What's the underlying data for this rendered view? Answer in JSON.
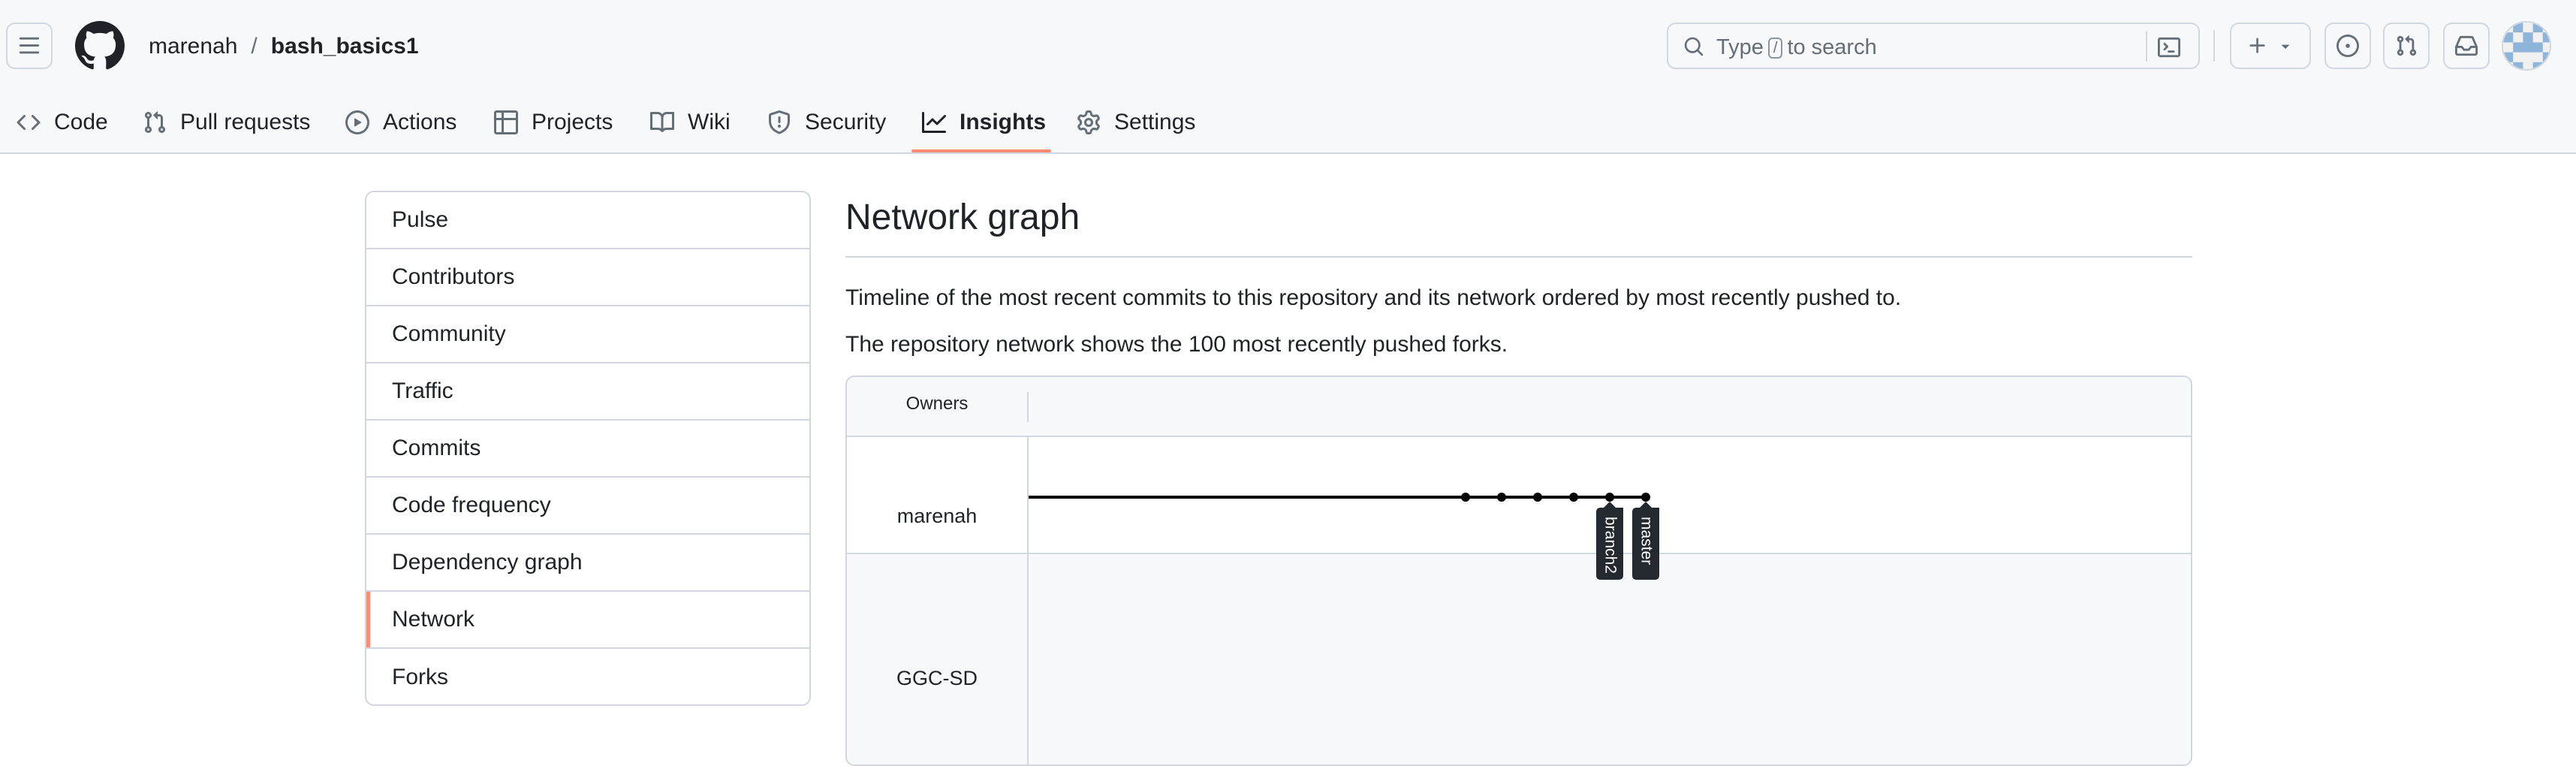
{
  "header": {
    "breadcrumb": {
      "owner": "marenah",
      "separator": "/",
      "repo": "bash_basics1"
    },
    "search": {
      "prefix": "Type",
      "key": "/",
      "suffix": "to search"
    }
  },
  "tabs": [
    {
      "label": "Code",
      "icon": "code-icon"
    },
    {
      "label": "Pull requests",
      "icon": "git-pull-request-icon"
    },
    {
      "label": "Actions",
      "icon": "play-icon"
    },
    {
      "label": "Projects",
      "icon": "table-icon"
    },
    {
      "label": "Wiki",
      "icon": "book-icon"
    },
    {
      "label": "Security",
      "icon": "shield-icon"
    },
    {
      "label": "Insights",
      "icon": "graph-icon",
      "active": true
    },
    {
      "label": "Settings",
      "icon": "gear-icon"
    }
  ],
  "sidebar": {
    "items": [
      {
        "label": "Pulse"
      },
      {
        "label": "Contributors"
      },
      {
        "label": "Community"
      },
      {
        "label": "Traffic"
      },
      {
        "label": "Commits"
      },
      {
        "label": "Code frequency"
      },
      {
        "label": "Dependency graph"
      },
      {
        "label": "Network",
        "selected": true
      },
      {
        "label": "Forks"
      }
    ]
  },
  "main": {
    "title": "Network graph",
    "description1": "Timeline of the most recent commits to this repository and its network ordered by most recently pushed to.",
    "description2": "The repository network shows the 100 most recently pushed forks."
  },
  "network": {
    "owners_label": "Owners",
    "owners": [
      "marenah",
      "GGC-SD"
    ],
    "commit_count": 6,
    "branches": [
      "branch2",
      "master"
    ]
  },
  "colors": {
    "accent": "#fd8c73",
    "border": "#d0d7de",
    "header_bg": "#f6f8fa",
    "text": "#1f2328",
    "muted": "#656d76",
    "branch_label_bg": "#24292f"
  }
}
